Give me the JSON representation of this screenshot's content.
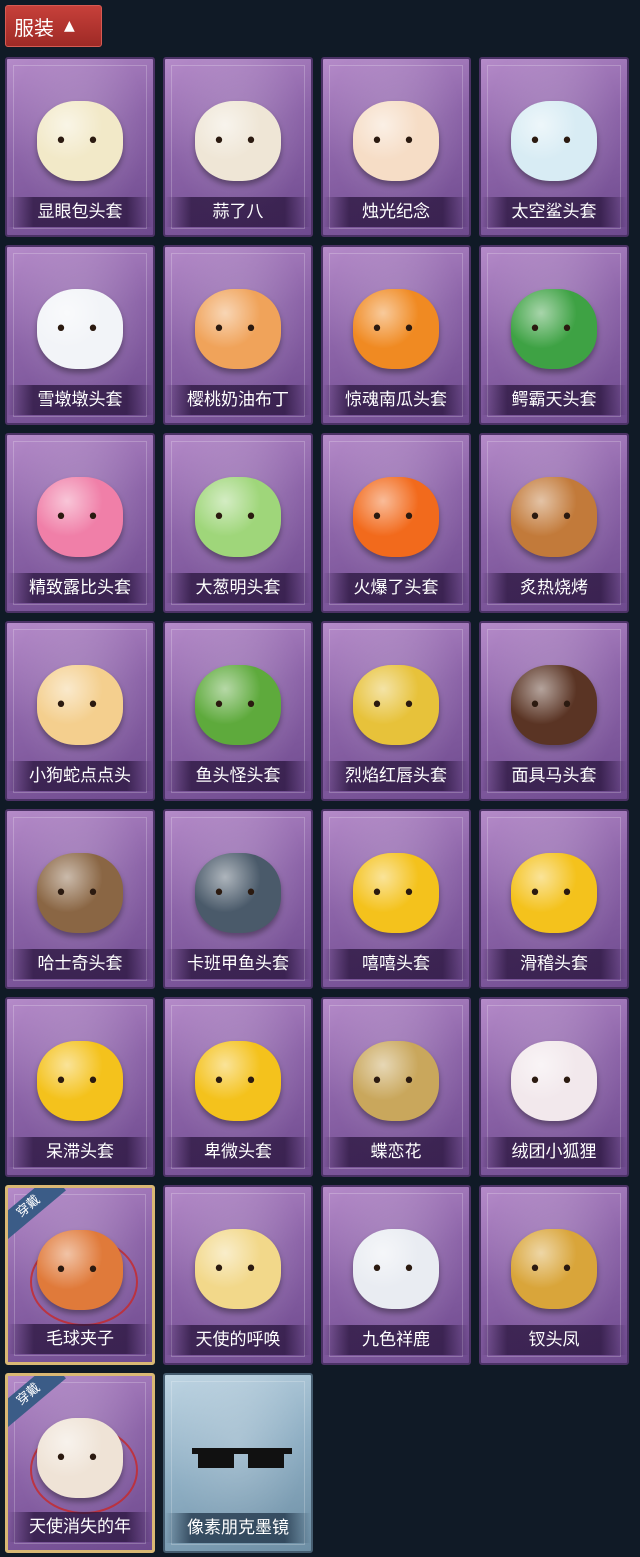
{
  "header": {
    "title": "服装",
    "chevron_icon": "chevron-up-icon"
  },
  "colors": {
    "header_bg": "#b3332e",
    "card_purple": "#8c64a8",
    "card_blue": "#8eaec3",
    "equipped_border": "#d9b874",
    "ribbon": "#3b5c87"
  },
  "equipped_badge": "穿戴",
  "items": [
    {
      "label": "显眼包头套",
      "icon": "bun-king-head-icon",
      "color": "#f2e9c8"
    },
    {
      "label": "蒜了八",
      "icon": "garlic-head-icon",
      "color": "#efe6d6"
    },
    {
      "label": "烛光纪念",
      "icon": "candle-head-icon",
      "color": "#f6ddc6"
    },
    {
      "label": "太空鲨头套",
      "icon": "space-shark-head-icon",
      "color": "#d8ecf4"
    },
    {
      "label": "雪墩墩头套",
      "icon": "snowman-head-icon",
      "color": "#f2f4f8"
    },
    {
      "label": "樱桃奶油布丁",
      "icon": "pudding-head-icon",
      "color": "#f0a35a"
    },
    {
      "label": "惊魂南瓜头套",
      "icon": "pumpkin-head-icon",
      "color": "#f08a22"
    },
    {
      "label": "鳄霸天头套",
      "icon": "crocodile-head-icon",
      "color": "#3ea244"
    },
    {
      "label": "精致露比头套",
      "icon": "pink-beaver-head-icon",
      "color": "#f07fa8"
    },
    {
      "label": "大葱明头套",
      "icon": "scallion-head-icon",
      "color": "#9fd67a"
    },
    {
      "label": "火爆了头套",
      "icon": "fire-head-icon",
      "color": "#f26a1c"
    },
    {
      "label": "炙热烧烤",
      "icon": "bbq-meat-head-icon",
      "color": "#c27a3a"
    },
    {
      "label": "小狗蛇点点头",
      "icon": "dog-snake-head-icon",
      "color": "#f4cf8e"
    },
    {
      "label": "鱼头怪头套",
      "icon": "fish-monster-head-icon",
      "color": "#5eaa3c"
    },
    {
      "label": "烈焰红唇头套",
      "icon": "yellow-mouse-head-icon",
      "color": "#e7c23a"
    },
    {
      "label": "面具马头套",
      "icon": "horse-mask-head-icon",
      "color": "#5a3424"
    },
    {
      "label": "哈士奇头套",
      "icon": "husky-head-icon",
      "color": "#8a6644"
    },
    {
      "label": "卡班甲鱼头套",
      "icon": "whale-head-icon",
      "color": "#4a5a6a"
    },
    {
      "label": "嘻嘻头套",
      "icon": "grin-emoji-head-icon",
      "color": "#f4c21c"
    },
    {
      "label": "滑稽头套",
      "icon": "smirk-emoji-head-icon",
      "color": "#f4c21c"
    },
    {
      "label": "呆滞头套",
      "icon": "dazed-emoji-head-icon",
      "color": "#f4c21c"
    },
    {
      "label": "卑微头套",
      "icon": "humble-emoji-head-icon",
      "color": "#f4c21c"
    },
    {
      "label": "蝶恋花",
      "icon": "butterfly-crown-icon",
      "color": "#c9a75c"
    },
    {
      "label": "绒团小狐狸",
      "icon": "fox-plush-icon",
      "color": "#f2e8ec"
    },
    {
      "label": "毛球夹子",
      "icon": "red-panda-clip-icon",
      "color": "#e07a3a",
      "equipped": true
    },
    {
      "label": "天使的呼唤",
      "icon": "angel-doll-icon",
      "color": "#f2d88a"
    },
    {
      "label": "九色祥鹿",
      "icon": "deer-ornament-icon",
      "color": "#e9ecf2"
    },
    {
      "label": "钗头凤",
      "icon": "phoenix-crown-icon",
      "color": "#d9a53a"
    },
    {
      "label": "天使消失的年",
      "icon": "veiled-angel-doll-icon",
      "color": "#efe3d6",
      "equipped": true
    },
    {
      "label": "像素朋克墨镜",
      "icon": "pixel-sunglasses-icon",
      "color": "#111111",
      "variant": "blue"
    }
  ]
}
